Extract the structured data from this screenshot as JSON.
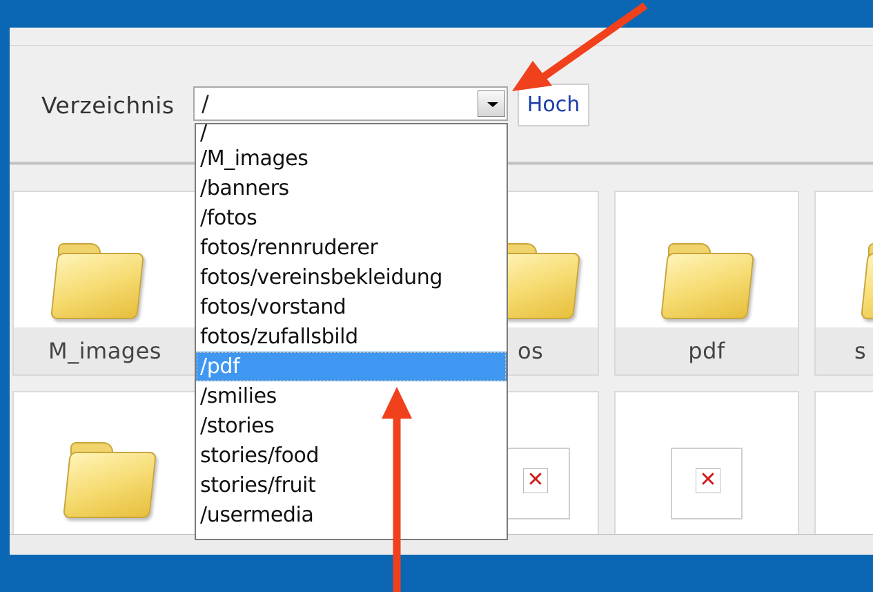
{
  "toolbar": {
    "label": "Verzeichnis",
    "selected_value": "/",
    "up_button": "Hoch"
  },
  "dropdown": {
    "options": [
      "/",
      "/M_images",
      "/banners",
      "/fotos",
      "fotos/rennruderer",
      "fotos/vereinsbekleidung",
      "fotos/vorstand",
      "fotos/zufallsbild",
      "/pdf",
      "/smilies",
      "/stories",
      "stories/food",
      "stories/fruit",
      "/usermedia"
    ],
    "highlighted": "/pdf"
  },
  "tiles": {
    "row1": [
      "M_images",
      "os",
      "pdf",
      "s"
    ]
  },
  "colors": {
    "background": "#0b67b3",
    "highlight": "#3f97f2",
    "annotation_arrow": "#f0401c",
    "broken_image_x": "#d01c1c"
  },
  "icons": {
    "folder": "folder-icon",
    "broken_image": "broken-image-icon",
    "dropdown_toggle": "chevron-down-icon"
  }
}
